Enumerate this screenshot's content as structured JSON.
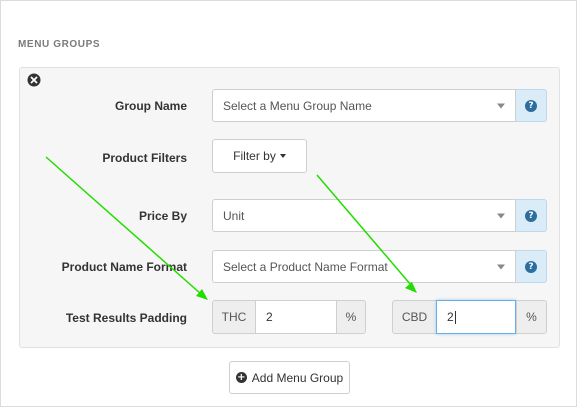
{
  "section": {
    "title": "MENU GROUPS"
  },
  "form": {
    "group_name": {
      "label": "Group Name",
      "placeholder": "Select a Menu Group Name"
    },
    "product_filters": {
      "label": "Product Filters",
      "button_label": "Filter by"
    },
    "price_by": {
      "label": "Price By",
      "value": "Unit"
    },
    "product_name_format": {
      "label": "Product Name Format",
      "placeholder": "Select a Product Name Format"
    },
    "test_results_padding": {
      "label": "Test Results Padding",
      "thc_label": "THC",
      "thc_value": "2",
      "thc_unit": "%",
      "cbd_label": "CBD",
      "cbd_value": "2",
      "cbd_unit": "%"
    }
  },
  "actions": {
    "add_menu_group": "Add Menu Group"
  },
  "icons": {
    "help": "question-circle-icon",
    "remove": "times-circle-icon",
    "add": "plus-circle-icon",
    "dropdown": "caret-down-icon"
  },
  "colors": {
    "help_bg": "#d9ecf7",
    "help_icon": "#2d6ea0",
    "annotation_arrow": "#22dd00",
    "focus_border": "#66afe9"
  }
}
